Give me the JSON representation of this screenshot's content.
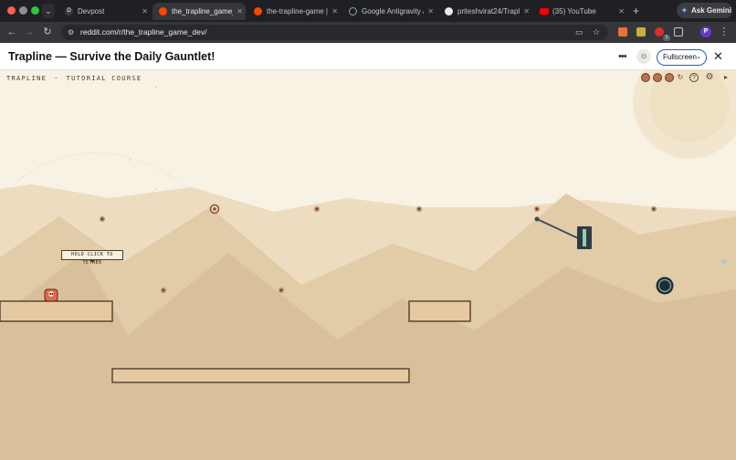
{
  "browser": {
    "tabs": [
      {
        "title": "Devpost",
        "favicon_color": "#3a3c40",
        "favicon_letter": "D",
        "active": false
      },
      {
        "title": "the_trapline_game_",
        "favicon_color": "#ff4500",
        "active": true
      },
      {
        "title": "the-trapline-game |",
        "favicon_color": "#ff4500",
        "active": false
      },
      {
        "title": "Google Antigravity /",
        "favicon_color": "#9aa0a6",
        "active": false
      },
      {
        "title": "priteshvirat24/Trapli",
        "favicon_color": "#e8eaed",
        "active": false
      },
      {
        "title": "(35) YouTube",
        "favicon_color": "#ff0000",
        "active": false
      }
    ],
    "ask_gemini_label": "Ask Gemini",
    "url": "reddit.com/r/the_trapline_game_dev/",
    "extension_badge": "1",
    "profile_initial": "P"
  },
  "app": {
    "title": "Trapline — Survive the Daily Gauntlet!",
    "fullscreen_label": "Fullscreen"
  },
  "game": {
    "hud": {
      "brand": "TRAPLINE",
      "separator": "·",
      "course_label": "TUTORIAL COURSE"
    },
    "tooltip": "HOLD CLICK TO TETHER",
    "colors": {
      "sky": "#f8f2e4",
      "hill_far": "#eddcc0",
      "hill_mid": "#e2cba7",
      "hill_near": "#d8c09b",
      "platform": "#e4c9a3",
      "platform_border": "#5a4632",
      "player": "#e0694a",
      "tether": "#3a4a5c",
      "portal": "#2f3f47"
    }
  }
}
